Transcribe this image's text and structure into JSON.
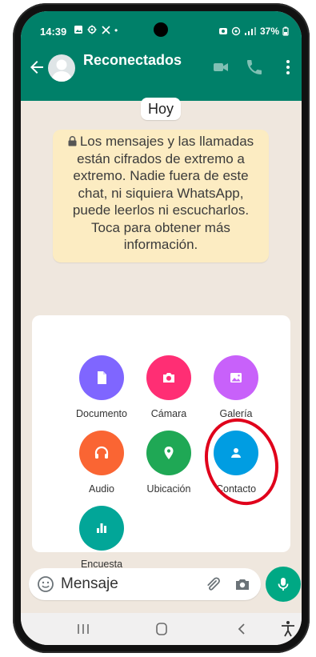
{
  "status_bar": {
    "time": "14:39",
    "left_icons": [
      "gallery-icon",
      "settings-icon",
      "x-icon"
    ],
    "right_icons": [
      "alarm-icon",
      "hotspot-icon",
      "signal-icon"
    ],
    "battery": "37%"
  },
  "header": {
    "contact_name": "Reconectados",
    "actions": [
      "video-call-icon",
      "voice-call-icon",
      "more-options-icon"
    ]
  },
  "chat": {
    "date_label": "Hoy",
    "encryption_notice": "Los mensajes y las llamadas están cifrados de extremo a extremo. Nadie fuera de este chat, ni siquiera WhatsApp, puede leerlos ni escucharlos. Toca para obtener más información."
  },
  "attach_menu": {
    "items": [
      {
        "label": "Documento",
        "icon": "document-icon",
        "color": "#7f66ff"
      },
      {
        "label": "Cámara",
        "icon": "camera-icon",
        "color": "#ff2e74"
      },
      {
        "label": "Galería",
        "icon": "gallery-icon",
        "color": "#c861fa"
      },
      {
        "label": "Audio",
        "icon": "headphones-icon",
        "color": "#fa6533"
      },
      {
        "label": "Ubicación",
        "icon": "location-icon",
        "color": "#1fa855"
      },
      {
        "label": "Contacto",
        "icon": "contact-icon",
        "color": "#009de2"
      },
      {
        "label": "Encuesta",
        "icon": "poll-icon",
        "color": "#02a698"
      }
    ],
    "highlighted": "Contacto",
    "highlight_color": "#e0001b"
  },
  "input_bar": {
    "placeholder": "Mensaje"
  },
  "colors": {
    "header": "#008069",
    "chat_background": "#efe7de",
    "notice_background": "#fcecc2",
    "send_button": "#00a884"
  }
}
